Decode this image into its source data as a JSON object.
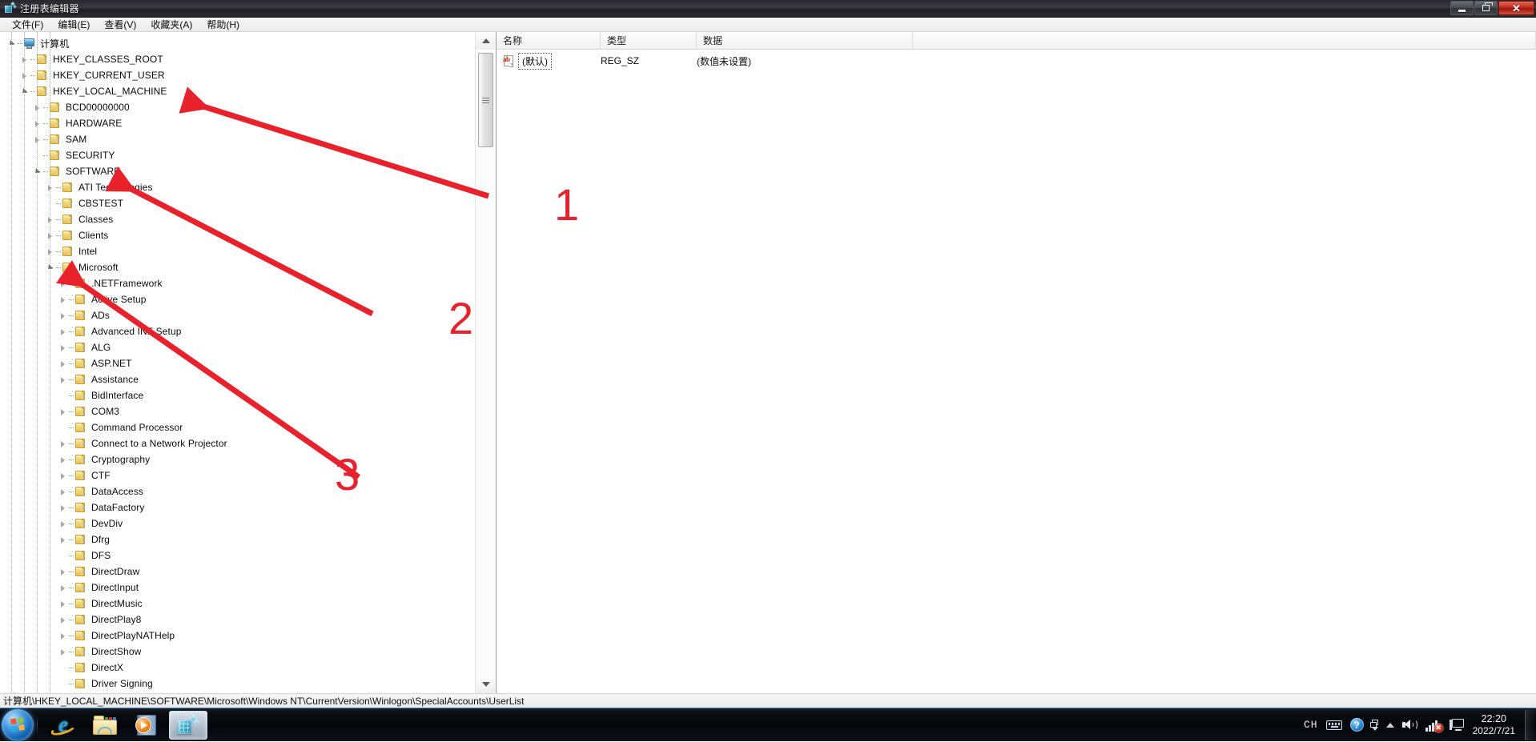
{
  "window": {
    "title": "注册表编辑器",
    "title_icon": "registry-cube-icon",
    "controls": {
      "minimize": "–",
      "restore": "❐",
      "close": "✕"
    }
  },
  "menu": [
    {
      "label": "文件(F)",
      "name": "menu-file"
    },
    {
      "label": "编辑(E)",
      "name": "menu-edit"
    },
    {
      "label": "查看(V)",
      "name": "menu-view"
    },
    {
      "label": "收藏夹(A)",
      "name": "menu-favorites"
    },
    {
      "label": "帮助(H)",
      "name": "menu-help"
    }
  ],
  "tree": {
    "root": {
      "label": "计算机",
      "icon": "computer-icon",
      "indent": 0,
      "state": "expanded"
    },
    "nodes": [
      {
        "label": "HKEY_CLASSES_ROOT",
        "indent": 1,
        "state": "collapsed"
      },
      {
        "label": "HKEY_CURRENT_USER",
        "indent": 1,
        "state": "collapsed"
      },
      {
        "label": "HKEY_LOCAL_MACHINE",
        "indent": 1,
        "state": "expanded"
      },
      {
        "label": "BCD00000000",
        "indent": 2,
        "state": "collapsed"
      },
      {
        "label": "HARDWARE",
        "indent": 2,
        "state": "collapsed"
      },
      {
        "label": "SAM",
        "indent": 2,
        "state": "collapsed"
      },
      {
        "label": "SECURITY",
        "indent": 2,
        "state": "leaf"
      },
      {
        "label": "SOFTWARE",
        "indent": 2,
        "state": "expanded"
      },
      {
        "label": "ATI Technologies",
        "indent": 3,
        "state": "collapsed"
      },
      {
        "label": "CBSTEST",
        "indent": 3,
        "state": "leaf"
      },
      {
        "label": "Classes",
        "indent": 3,
        "state": "collapsed"
      },
      {
        "label": "Clients",
        "indent": 3,
        "state": "collapsed"
      },
      {
        "label": "Intel",
        "indent": 3,
        "state": "collapsed"
      },
      {
        "label": "Microsoft",
        "indent": 3,
        "state": "expanded"
      },
      {
        "label": ".NETFramework",
        "indent": 4,
        "state": "collapsed"
      },
      {
        "label": "Active Setup",
        "indent": 4,
        "state": "collapsed"
      },
      {
        "label": "ADs",
        "indent": 4,
        "state": "collapsed"
      },
      {
        "label": "Advanced INF Setup",
        "indent": 4,
        "state": "collapsed"
      },
      {
        "label": "ALG",
        "indent": 4,
        "state": "collapsed"
      },
      {
        "label": "ASP.NET",
        "indent": 4,
        "state": "collapsed"
      },
      {
        "label": "Assistance",
        "indent": 4,
        "state": "collapsed"
      },
      {
        "label": "BidInterface",
        "indent": 4,
        "state": "leaf"
      },
      {
        "label": "COM3",
        "indent": 4,
        "state": "collapsed"
      },
      {
        "label": "Command Processor",
        "indent": 4,
        "state": "leaf"
      },
      {
        "label": "Connect to a Network Projector",
        "indent": 4,
        "state": "collapsed"
      },
      {
        "label": "Cryptography",
        "indent": 4,
        "state": "collapsed"
      },
      {
        "label": "CTF",
        "indent": 4,
        "state": "collapsed"
      },
      {
        "label": "DataAccess",
        "indent": 4,
        "state": "collapsed"
      },
      {
        "label": "DataFactory",
        "indent": 4,
        "state": "collapsed"
      },
      {
        "label": "DevDiv",
        "indent": 4,
        "state": "collapsed"
      },
      {
        "label": "Dfrg",
        "indent": 4,
        "state": "collapsed"
      },
      {
        "label": "DFS",
        "indent": 4,
        "state": "leaf"
      },
      {
        "label": "DirectDraw",
        "indent": 4,
        "state": "collapsed"
      },
      {
        "label": "DirectInput",
        "indent": 4,
        "state": "collapsed"
      },
      {
        "label": "DirectMusic",
        "indent": 4,
        "state": "collapsed"
      },
      {
        "label": "DirectPlay8",
        "indent": 4,
        "state": "collapsed"
      },
      {
        "label": "DirectPlayNATHelp",
        "indent": 4,
        "state": "collapsed"
      },
      {
        "label": "DirectShow",
        "indent": 4,
        "state": "collapsed"
      },
      {
        "label": "DirectX",
        "indent": 4,
        "state": "leaf"
      },
      {
        "label": "Driver Signing",
        "indent": 4,
        "state": "leaf"
      }
    ]
  },
  "list": {
    "columns": [
      {
        "label": "名称",
        "name": "column-name"
      },
      {
        "label": "类型",
        "name": "column-type"
      },
      {
        "label": "数据",
        "name": "column-data"
      }
    ],
    "rows": [
      {
        "name": "(默认)",
        "type": "REG_SZ",
        "data": "(数值未设置)",
        "icon": "string-value-icon"
      }
    ]
  },
  "status": {
    "path": "计算机\\HKEY_LOCAL_MACHINE\\SOFTWARE\\Microsoft\\Windows NT\\CurrentVersion\\Winlogon\\SpecialAccounts\\UserList"
  },
  "annotations": {
    "color": "#e8212b",
    "numbers": [
      {
        "text": "1",
        "target": "HKEY_LOCAL_MACHINE"
      },
      {
        "text": "2",
        "target": "SOFTWARE"
      },
      {
        "text": "3",
        "target": "Microsoft"
      }
    ]
  },
  "taskbar": {
    "start": {
      "name": "start-orb",
      "label": ""
    },
    "buttons": [
      {
        "name": "taskbar-internet-explorer",
        "icon": "internet-explorer-icon",
        "active": false
      },
      {
        "name": "taskbar-windows-explorer",
        "icon": "folder-explorer-icon",
        "active": false
      },
      {
        "name": "taskbar-media-player",
        "icon": "media-player-icon",
        "active": false
      },
      {
        "name": "taskbar-registry-editor",
        "icon": "registry-cube-icon",
        "active": true
      }
    ],
    "tray": {
      "ime": "CH",
      "icons": [
        {
          "name": "keyboard-icon"
        },
        {
          "name": "help-icon",
          "glyph": "?"
        },
        {
          "name": "show-hidden-icons-icon"
        },
        {
          "name": "volume-icon"
        },
        {
          "name": "network-disconnected-icon",
          "badge": "✕"
        },
        {
          "name": "display-icon"
        }
      ],
      "clock": {
        "time": "22:20",
        "date": "2022/7/21"
      }
    }
  }
}
